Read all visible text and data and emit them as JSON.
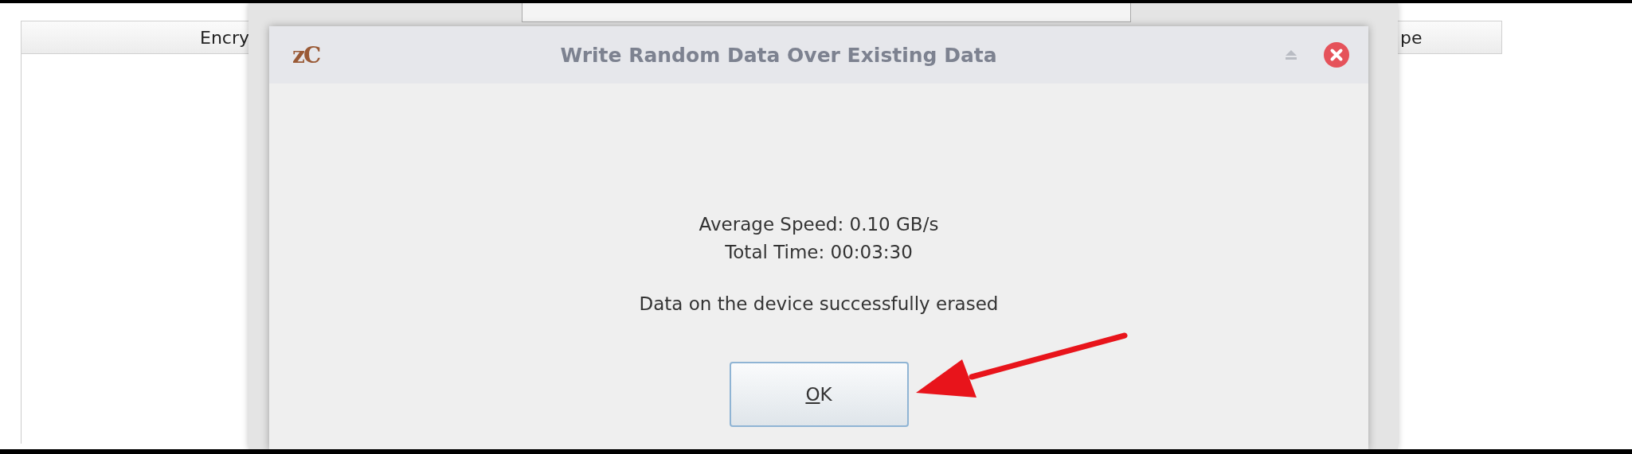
{
  "background_table": {
    "columns": [
      {
        "label": "Encry"
      },
      {
        "label": "pe"
      }
    ]
  },
  "dialog": {
    "logo": "zC",
    "title": "Write Random Data Over Existing Data",
    "lines": [
      "Average Speed: 0.10 GB/s",
      "Total Time: 00:03:30"
    ],
    "message": "Data on the device successfully erased",
    "buttons": [
      {
        "label": "OK"
      }
    ]
  }
}
